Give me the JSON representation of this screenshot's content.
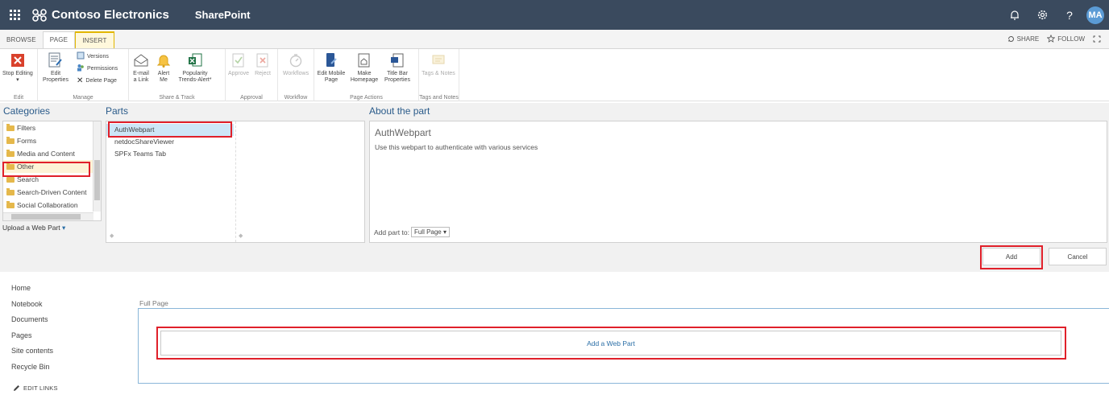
{
  "suitebar": {
    "brand": "Contoso Electronics",
    "app": "SharePoint",
    "user_initials": "MA",
    "help": "?"
  },
  "ribbon_tabs": {
    "browse": "BROWSE",
    "page": "PAGE",
    "insert": "INSERT",
    "share": "SHARE",
    "follow": "FOLLOW"
  },
  "ribbon": {
    "edit": {
      "stop_editing": "Stop Editing",
      "group": "Edit"
    },
    "manage": {
      "edit_properties": "Edit Properties",
      "versions": "Versions",
      "permissions": "Permissions",
      "delete_page": "Delete Page",
      "group": "Manage"
    },
    "share_track": {
      "email_link": "E-mail a Link",
      "alert_me": "Alert Me",
      "popularity": "Popularity Trends-Alert*",
      "group": "Share & Track"
    },
    "approval": {
      "approve": "Approve",
      "reject": "Reject",
      "group": "Approval"
    },
    "workflow": {
      "workflows": "Workflows",
      "group": "Workflow"
    },
    "page_actions": {
      "edit_mobile": "Edit Mobile Page",
      "make_homepage": "Make Homepage",
      "title_bar": "Title Bar Properties",
      "group": "Page Actions"
    },
    "tags": {
      "tags_notes": "Tags & Notes",
      "group": "Tags and Notes"
    }
  },
  "webpart_panel": {
    "categories_heading": "Categories",
    "parts_heading": "Parts",
    "about_heading": "About the part",
    "categories": [
      "Filters",
      "Forms",
      "Media and Content",
      "Other",
      "Search",
      "Search-Driven Content",
      "Social Collaboration"
    ],
    "selected_category": "Other",
    "upload": "Upload a Web Part",
    "parts": [
      "AuthWebpart",
      "netdocShareViewer",
      "SPFx Teams Tab"
    ],
    "selected_part": "AuthWebpart",
    "about_title": "AuthWebpart",
    "about_desc": "Use this webpart to authenticate with various services",
    "add_part_to_label": "Add part to:",
    "add_part_to_value": "Full Page",
    "add_button": "Add",
    "cancel_button": "Cancel"
  },
  "leftnav": {
    "items": [
      "Home",
      "Notebook",
      "Documents",
      "Pages",
      "Site contents",
      "Recycle Bin"
    ],
    "edit_links": "EDIT LINKS"
  },
  "zone": {
    "label": "Full Page",
    "add_web_part": "Add a Web Part"
  },
  "colors": {
    "suitebar": "#3a4a5e",
    "highlight": "#e0202a",
    "link": "#2a6ea6"
  }
}
